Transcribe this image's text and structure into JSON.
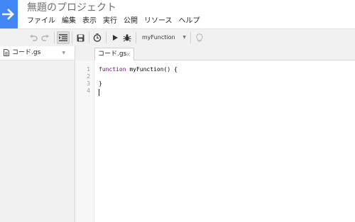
{
  "app": {
    "title": "無題のプロジェクト"
  },
  "menu": [
    "ファイル",
    "編集",
    "表示",
    "実行",
    "公開",
    "リソース",
    "ヘルプ"
  ],
  "toolbar": {
    "function_select": "myFunction"
  },
  "sidebar": {
    "file_name": "コード.gs"
  },
  "tabs": [
    {
      "label": "コード.gs",
      "close": "×"
    }
  ],
  "editor": {
    "line_numbers": [
      "1",
      "2",
      "3",
      "4"
    ],
    "lines": {
      "line1_keyword": "function",
      "line1_rest": " myFunction() {",
      "line3": "}"
    }
  },
  "colors": {
    "brand": "#4285f4",
    "keyword": "#7a0080"
  }
}
